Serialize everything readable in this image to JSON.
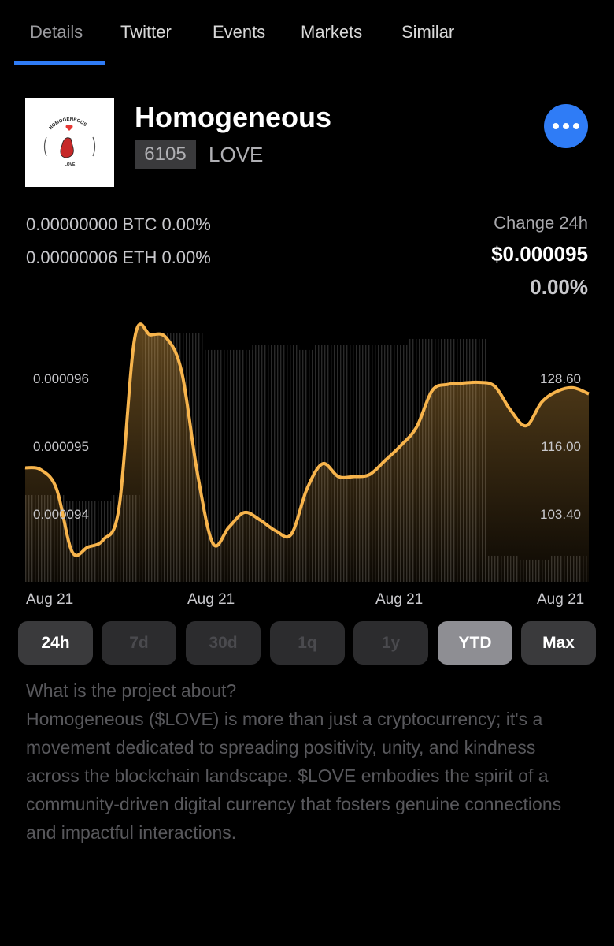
{
  "tabs": [
    "Details",
    "Twitter",
    "Events",
    "Markets",
    "Similar"
  ],
  "coin": {
    "name": "Homogeneous",
    "rank": "6105",
    "symbol": "LOVE",
    "logo_text": [
      "HOMOGENEOUS",
      "LOVE"
    ]
  },
  "conversions": [
    "0.00000000 BTC 0.00%",
    "0.00000006 ETH 0.00%"
  ],
  "change": {
    "label": "Change 24h",
    "value": "$0.000095",
    "percent": "0.00%"
  },
  "colors": {
    "accent": "#2f7cf6",
    "line": "#f7b44c"
  },
  "chart_data": {
    "type": "line",
    "x_tick_labels": [
      "Aug 21",
      "Aug 21",
      "Aug 21",
      "Aug 21"
    ],
    "left_ticks": [
      "0.000096",
      "0.000095",
      "0.000094"
    ],
    "right_ticks": [
      "128.60",
      "116.00",
      "103.40"
    ],
    "ylim": [
      9.2988e-05,
      9.6686e-05
    ],
    "volume_ylim": [
      90.65,
      137.24
    ],
    "series": [
      {
        "values": [
          9.467e-05,
          9.464e-05,
          9.436e-05,
          9.343e-05,
          9.35e-05,
          9.361e-05,
          9.409e-05,
          9.659e-05,
          9.663e-05,
          9.659e-05,
          9.608e-05,
          9.459e-05,
          9.355e-05,
          9.379e-05,
          9.401e-05,
          9.39e-05,
          9.374e-05,
          9.369e-05,
          9.436e-05,
          9.473e-05,
          9.454e-05,
          9.454e-05,
          9.457e-05,
          9.478e-05,
          9.5e-05,
          9.527e-05,
          9.581e-05,
          9.59e-05,
          9.592e-05,
          9.593e-05,
          9.587e-05,
          9.552e-05,
          9.529e-05,
          9.564e-05,
          9.58e-05,
          9.585e-05,
          9.576e-05
        ]
      },
      {
        "values": [
          106.77,
          106.77,
          106.77,
          105.74,
          105.74,
          105.74,
          106.77,
          106.77,
          136.95,
          136.95,
          136.95,
          136.95,
          133.73,
          133.73,
          133.73,
          134.75,
          134.75,
          134.75,
          133.73,
          134.75,
          134.75,
          134.75,
          134.75,
          134.75,
          134.75,
          135.78,
          135.78,
          135.78,
          135.78,
          135.78,
          95.49,
          95.49,
          94.76,
          94.76,
          95.49,
          95.49,
          95.49
        ]
      }
    ]
  },
  "ranges": [
    {
      "label": "24h",
      "state": "normal"
    },
    {
      "label": "7d",
      "state": "disabled"
    },
    {
      "label": "30d",
      "state": "disabled"
    },
    {
      "label": "1q",
      "state": "disabled"
    },
    {
      "label": "1y",
      "state": "disabled"
    },
    {
      "label": "YTD",
      "state": "selected"
    },
    {
      "label": "Max",
      "state": "normal"
    }
  ],
  "description": {
    "heading": "What is the project about?",
    "body": "Homogeneous ($LOVE) is more than just a cryptocurrency; it's a movement dedicated to spreading positivity, unity, and kindness across the blockchain landscape. $LOVE embodies the spirit of a community-driven digital currency that fosters genuine connections and impactful interactions."
  }
}
